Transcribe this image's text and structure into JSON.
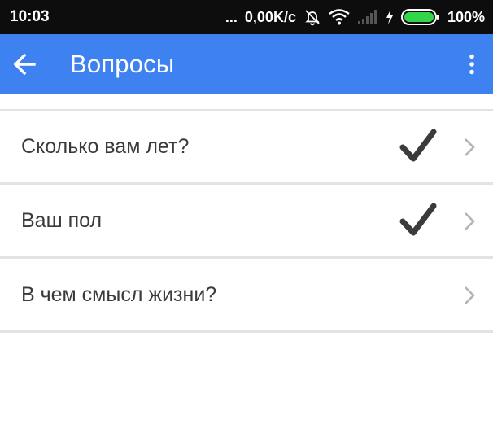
{
  "status_bar": {
    "time": "10:03",
    "dots": "...",
    "network_speed": "0,00K/c",
    "battery_percent": "100%",
    "icons": [
      "bell-off-icon",
      "wifi-icon",
      "signal-icon",
      "charging-icon",
      "battery-icon"
    ]
  },
  "app_bar": {
    "title": "Вопросы",
    "back_icon": "arrow-left-icon",
    "menu_icon": "more-vert-icon",
    "color": "#3d82f0"
  },
  "questions": [
    {
      "label": "Сколько вам лет?",
      "answered": true
    },
    {
      "label": "Ваш пол",
      "answered": true
    },
    {
      "label": "В чем смысл жизни?",
      "answered": false
    }
  ]
}
